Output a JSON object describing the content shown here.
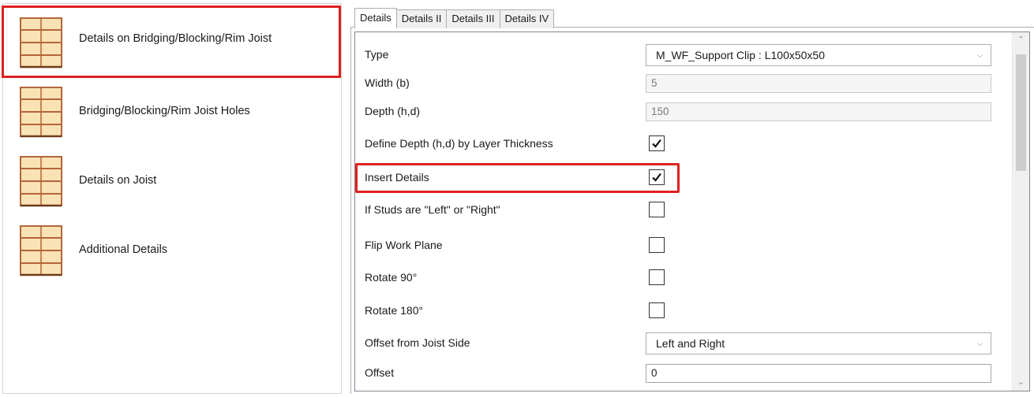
{
  "left_list": {
    "items": [
      {
        "label": "Details on Bridging/Blocking/Rim Joist",
        "icon": "joist-icon",
        "selected": true
      },
      {
        "label": "Bridging/Blocking/Rim Joist Holes",
        "icon": "joist-icon",
        "selected": false
      },
      {
        "label": "Details on Joist",
        "icon": "joist-icon",
        "selected": false
      },
      {
        "label": "Additional Details",
        "icon": "joist-icon",
        "selected": false
      }
    ]
  },
  "tabs": [
    {
      "label": "Details",
      "active": true
    },
    {
      "label": "Details II",
      "active": false
    },
    {
      "label": "Details III",
      "active": false
    },
    {
      "label": "Details IV",
      "active": false
    }
  ],
  "properties": {
    "type": {
      "label": "Type",
      "value": "M_WF_Support Clip : L100x50x50"
    },
    "width": {
      "label": "Width (b)",
      "value": "5"
    },
    "depth": {
      "label": "Depth (h,d)",
      "value": "150"
    },
    "define_depth": {
      "label": "Define Depth (h,d) by Layer Thickness",
      "checked": true
    },
    "insert_details": {
      "label": "Insert Details",
      "checked": true
    },
    "studs_left_right": {
      "label": "If Studs are \"Left\" or \"Right\"",
      "checked": false
    },
    "flip_work_plane": {
      "label": "Flip Work Plane",
      "checked": false
    },
    "rotate_90": {
      "label": "Rotate 90°",
      "checked": false
    },
    "rotate_180": {
      "label": "Rotate 180°",
      "checked": false
    },
    "offset_side": {
      "label": "Offset from Joist Side",
      "value": "Left and Right"
    },
    "offset": {
      "label": "Offset",
      "value": "0"
    }
  },
  "icons": {
    "dropdown": "chevron-down-icon",
    "scroll_up": "scroll-up-icon",
    "scroll_down": "scroll-down-icon"
  },
  "colors": {
    "highlight": "#e02020",
    "joist_fill": "#f9e3b4",
    "joist_stroke": "#b5653a"
  }
}
